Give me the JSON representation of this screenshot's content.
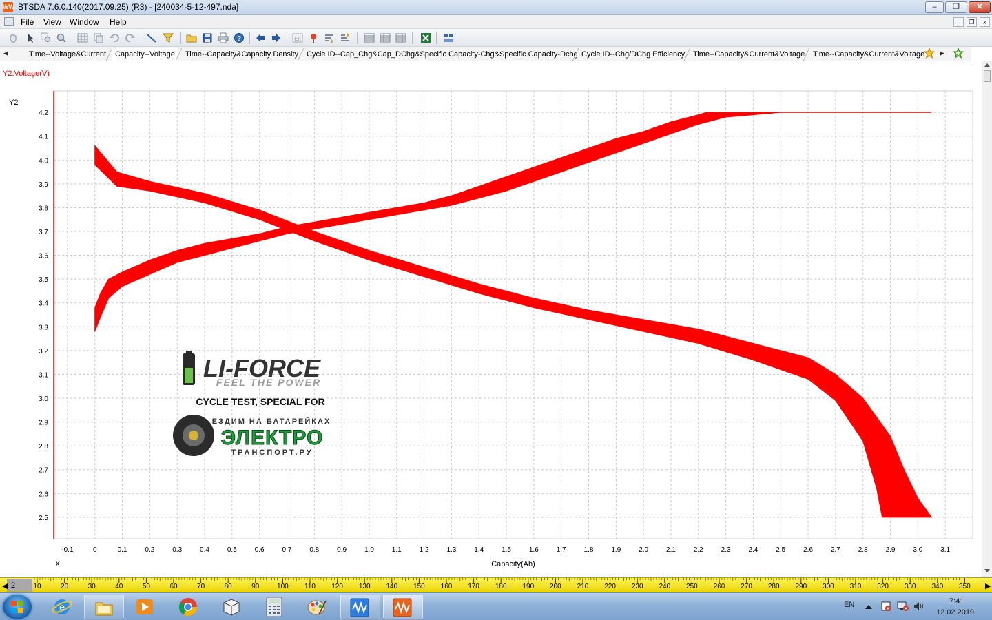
{
  "window": {
    "app_icon_text": "WW",
    "title": "BTSDA 7.6.0.140(2017.09.25) (R3) - [240034-5-12-497.nda]",
    "buttons": {
      "minimize": "–",
      "maximize": "❐",
      "close": "✕"
    }
  },
  "menu": {
    "items": [
      "File",
      "View",
      "Window",
      "Help"
    ],
    "mdi_buttons": {
      "minimize": "_",
      "restore": "❐",
      "close": "x"
    }
  },
  "toolbar": {
    "icons": [
      "hand-icon",
      "pointer-icon",
      "zoom-rect-icon",
      "zoom-icon",
      "grid-icon",
      "copy-icon",
      "undo-icon",
      "redo-icon",
      "line-icon",
      "filter-icon",
      "open-folder-icon",
      "save-icon",
      "print-icon",
      "help-icon",
      "back-icon",
      "forward-icon",
      "language-icon",
      "pin-icon",
      "sort-asc-icon",
      "sort-desc-icon",
      "table-icon",
      "table2-icon",
      "table3-icon",
      "excel-icon",
      "layout-icon"
    ]
  },
  "tabs": {
    "scroll_left": "◀",
    "scroll_right": "▶",
    "items": [
      {
        "label": "Time--Voltage&Current",
        "active": false
      },
      {
        "label": "Capacity--Voltage",
        "active": true
      },
      {
        "label": "Time--Capacity&Capacity Density",
        "active": false
      },
      {
        "label": "Cycle ID--Cap_Chg&Cap_DChg&Specific Capacity-Chg&Specific Capacity-Dchg",
        "active": false
      },
      {
        "label": "Cycle ID--Chg/DChg Efficiency",
        "active": false
      },
      {
        "label": "Time--Capacity&Current&Voltage",
        "active": false
      },
      {
        "label": "Time--Capacity&Current&Voltage",
        "active": false
      }
    ]
  },
  "chart_data": {
    "type": "line",
    "title": "Y2:Voltage(V)",
    "y_axis_name": "Y2",
    "x_axis_name": "X",
    "xlabel": "Capacity(Ah)",
    "ylabel": "Voltage(V)",
    "xlim": [
      -0.15,
      3.2
    ],
    "ylim": [
      2.41,
      4.29
    ],
    "xticks": [
      -0.1,
      0,
      0.1,
      0.2,
      0.3,
      0.4,
      0.5,
      0.6,
      0.7,
      0.8,
      0.9,
      1.0,
      1.1,
      1.2,
      1.3,
      1.4,
      1.5,
      1.6,
      1.7,
      1.8,
      1.9,
      2.0,
      2.1,
      2.2,
      2.3,
      2.4,
      2.5,
      2.6,
      2.7,
      2.8,
      2.9,
      3.0,
      3.1
    ],
    "xtick_labels": [
      "-0.1",
      "0",
      "0.1",
      "0.2",
      "0.3",
      "0.4",
      "0.5",
      "0.6",
      "0.7",
      "0.8",
      "0.9",
      "1.0",
      "1.1",
      "1.2",
      "1.3",
      "1.4",
      "1.5",
      "1.6",
      "1.7",
      "1.8",
      "1.9",
      "2.0",
      "2.1",
      "2.2",
      "2.3",
      "2.4",
      "2.5",
      "2.6",
      "2.7",
      "2.8",
      "2.9",
      "3.0",
      "3.1"
    ],
    "yticks": [
      2.5,
      2.6,
      2.7,
      2.8,
      2.9,
      3.0,
      3.1,
      3.2,
      3.3,
      3.4,
      3.5,
      3.6,
      3.7,
      3.8,
      3.9,
      4.0,
      4.1,
      4.2
    ],
    "ytick_labels": [
      "2.5",
      "2.6",
      "2.7",
      "2.8",
      "2.9",
      "3.0",
      "3.1",
      "3.2",
      "3.3",
      "3.4",
      "3.5",
      "3.6",
      "3.7",
      "3.8",
      "3.9",
      "4.0",
      "4.1",
      "4.2"
    ],
    "grid": true,
    "color": "#ff0000",
    "bands": [
      {
        "kind": "charge",
        "upper": {
          "x": [
            0.0,
            0.02,
            0.05,
            0.1,
            0.2,
            0.3,
            0.4,
            0.5,
            0.6,
            0.7,
            0.8,
            0.9,
            1.0,
            1.1,
            1.2,
            1.3,
            1.4,
            1.5,
            1.6,
            1.7,
            1.8,
            1.9,
            2.0,
            2.1,
            2.2,
            2.23,
            2.4,
            2.5,
            2.51
          ],
          "y": [
            3.38,
            3.44,
            3.5,
            3.53,
            3.58,
            3.62,
            3.65,
            3.67,
            3.69,
            3.72,
            3.74,
            3.76,
            3.78,
            3.8,
            3.82,
            3.85,
            3.89,
            3.93,
            3.97,
            4.01,
            4.05,
            4.09,
            4.12,
            4.16,
            4.19,
            4.2,
            4.2,
            4.2,
            4.2
          ]
        },
        "lower": {
          "x": [
            0.0,
            0.02,
            0.05,
            0.1,
            0.2,
            0.3,
            0.4,
            0.5,
            0.6,
            0.7,
            0.8,
            0.9,
            1.0,
            1.1,
            1.2,
            1.3,
            1.4,
            1.5,
            1.6,
            1.7,
            1.8,
            1.9,
            2.0,
            2.1,
            2.2,
            2.3,
            2.4,
            2.5,
            2.51
          ],
          "y": [
            3.28,
            3.34,
            3.42,
            3.47,
            3.52,
            3.57,
            3.6,
            3.63,
            3.66,
            3.69,
            3.71,
            3.73,
            3.75,
            3.77,
            3.79,
            3.81,
            3.84,
            3.87,
            3.91,
            3.95,
            3.99,
            4.03,
            4.07,
            4.11,
            4.15,
            4.18,
            4.19,
            4.2,
            4.2
          ]
        }
      },
      {
        "kind": "discharge",
        "upper": {
          "x": [
            0.0,
            0.08,
            0.2,
            0.4,
            0.6,
            0.8,
            1.0,
            1.2,
            1.4,
            1.6,
            1.8,
            2.0,
            2.2,
            2.4,
            2.6,
            2.7,
            2.8,
            2.9,
            2.95,
            3.0,
            3.05
          ],
          "y": [
            4.06,
            3.95,
            3.91,
            3.86,
            3.79,
            3.7,
            3.62,
            3.55,
            3.48,
            3.42,
            3.37,
            3.33,
            3.29,
            3.23,
            3.17,
            3.1,
            3.0,
            2.84,
            2.7,
            2.58,
            2.5
          ]
        },
        "lower": {
          "x": [
            0.0,
            0.08,
            0.2,
            0.4,
            0.6,
            0.8,
            1.0,
            1.2,
            1.4,
            1.6,
            1.8,
            2.0,
            2.2,
            2.4,
            2.6,
            2.7,
            2.8,
            2.85,
            2.87
          ],
          "y": [
            3.98,
            3.89,
            3.87,
            3.82,
            3.75,
            3.66,
            3.58,
            3.51,
            3.44,
            3.38,
            3.33,
            3.28,
            3.23,
            3.16,
            3.08,
            2.99,
            2.82,
            2.62,
            2.5
          ]
        }
      }
    ],
    "rest_line": {
      "x": [
        2.5,
        3.05
      ],
      "y": [
        4.2,
        4.2
      ]
    },
    "watermark": {
      "brand": "LI-FORCE",
      "slogan": "FEEL THE POWER",
      "cycle_text": "CYCLE TEST, SPECIAL FOR",
      "partner_top": "ЕЗДИМ НА БАТАРЕЙКАХ",
      "partner_main": "ЭЛЕКТРО",
      "partner_bottom": "ТРАНСПОРТ.РУ"
    }
  },
  "ruler": {
    "left_arrow": "◀",
    "right_arrow": "▶",
    "position_label": "2",
    "labels": [
      "10",
      "20",
      "30",
      "40",
      "50",
      "60",
      "70",
      "80",
      "90",
      "100",
      "110",
      "120",
      "130",
      "140",
      "150",
      "160",
      "170",
      "180",
      "190",
      "200",
      "210",
      "220",
      "230",
      "240",
      "250",
      "260",
      "270",
      "280",
      "290",
      "300",
      "310",
      "320",
      "330",
      "340",
      "350"
    ]
  },
  "taskbar": {
    "language": "EN",
    "time": "7:41",
    "date": "12.02.2019",
    "apps": [
      "start-button",
      "ie-icon",
      "explorer-icon",
      "media-player-icon",
      "chrome-icon",
      "package-icon",
      "calculator-icon",
      "paint-icon",
      "btsda-icon",
      "btsda-active-icon"
    ]
  }
}
